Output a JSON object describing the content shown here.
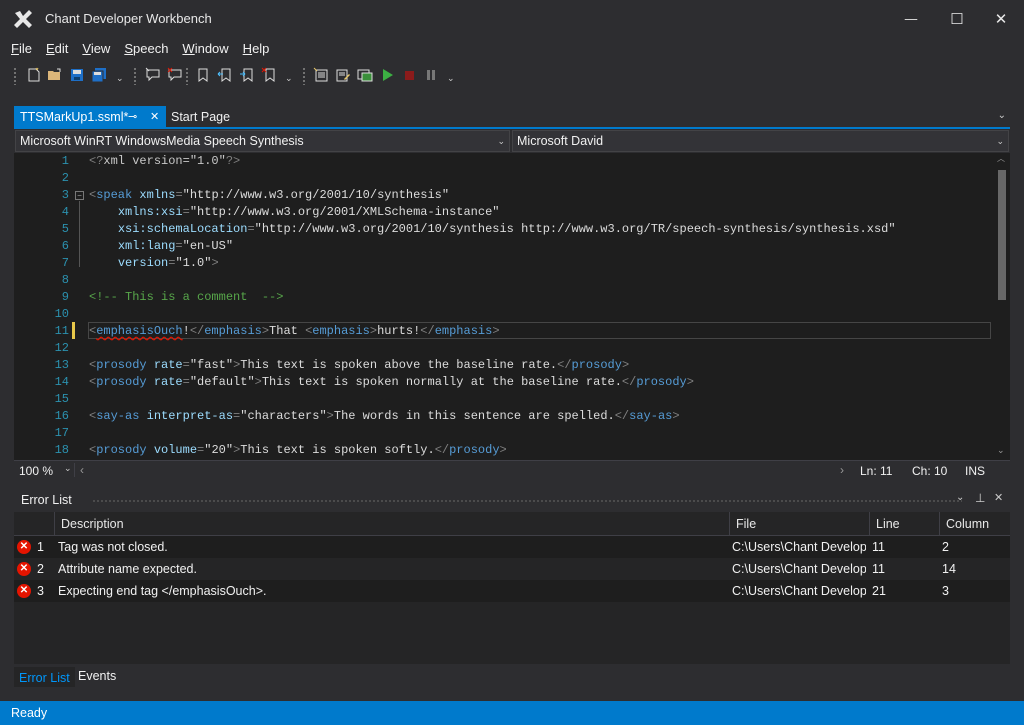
{
  "window": {
    "title": "Chant Developer Workbench",
    "minimize": "—",
    "maximize": "☐",
    "close": "✕"
  },
  "menu": [
    {
      "key": "F",
      "rest": "ile"
    },
    {
      "key": "E",
      "rest": "dit"
    },
    {
      "key": "V",
      "rest": "iew"
    },
    {
      "key": "S",
      "rest": "peech"
    },
    {
      "key": "W",
      "rest": "indow"
    },
    {
      "key": "H",
      "rest": "elp"
    }
  ],
  "tabs": {
    "active": "TTSMarkUp1.ssml*",
    "pin": "⊸",
    "close": "✕",
    "inactive": "Start Page",
    "overflow": "⌄"
  },
  "combos": {
    "engine": "Microsoft WinRT WindowsMedia Speech Synthesis",
    "voice": "Microsoft David"
  },
  "editor": {
    "line_numbers": [
      "1",
      "2",
      "3",
      "4",
      "5",
      "6",
      "7",
      "8",
      "9",
      "10",
      "11",
      "12",
      "13",
      "14",
      "15",
      "16",
      "17",
      "18"
    ],
    "zoom": "100 %",
    "ln": "Ln: 11",
    "ch": "Ch: 10",
    "mode": "INS"
  },
  "error_panel": {
    "title": "Error List",
    "columns": [
      "Description",
      "File",
      "Line",
      "Column"
    ],
    "rows": [
      {
        "num": "1",
        "desc": "Tag was not closed.",
        "file": "C:\\Users\\Chant Developn",
        "line": "11",
        "col": "2"
      },
      {
        "num": "2",
        "desc": "Attribute name expected.",
        "file": "C:\\Users\\Chant Developn",
        "line": "11",
        "col": "14"
      },
      {
        "num": "3",
        "desc": "Expecting end tag </emphasisOuch>.",
        "file": "C:\\Users\\Chant Developn",
        "line": "21",
        "col": "3"
      }
    ],
    "bottom_tabs": [
      "Error List",
      "Events"
    ]
  },
  "status": "Ready",
  "colors": {
    "accent": "#007acc",
    "background": "#2d2d30",
    "editor_bg": "#1e1e1e",
    "error": "#e51400"
  }
}
